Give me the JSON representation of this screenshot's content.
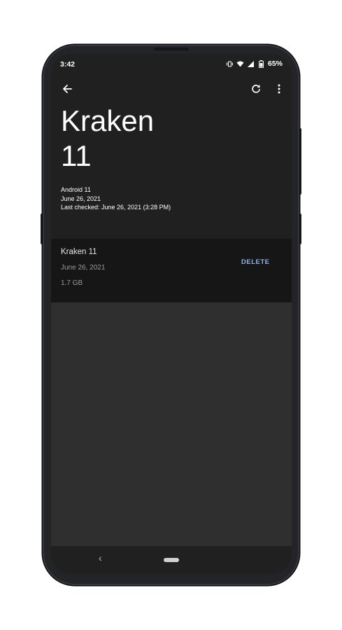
{
  "status_bar": {
    "time": "3:42",
    "battery": "65%",
    "icons": [
      "vibrate-icon",
      "wifi-icon",
      "signal-icon",
      "battery-icon"
    ]
  },
  "toolbar": {
    "back_icon": "arrow-left-icon",
    "refresh_icon": "refresh-icon",
    "menu_icon": "more-vert-icon"
  },
  "header": {
    "title_line1": "Kraken",
    "title_line2": "11",
    "android_version": "Android 11",
    "date": "June 26, 2021",
    "last_checked": "Last checked: June 26, 2021 (3:28 PM)"
  },
  "update_item": {
    "name": "Kraken 11",
    "date": "June 26, 2021",
    "size": "1.7 GB",
    "delete_label": "DELETE"
  },
  "nav_bar": {
    "back_glyph": "‹"
  },
  "colors": {
    "header_bg": "#202020",
    "card_bg": "#161616",
    "screen_bg": "#2f2f2f",
    "accent": "#8fb3ea"
  }
}
